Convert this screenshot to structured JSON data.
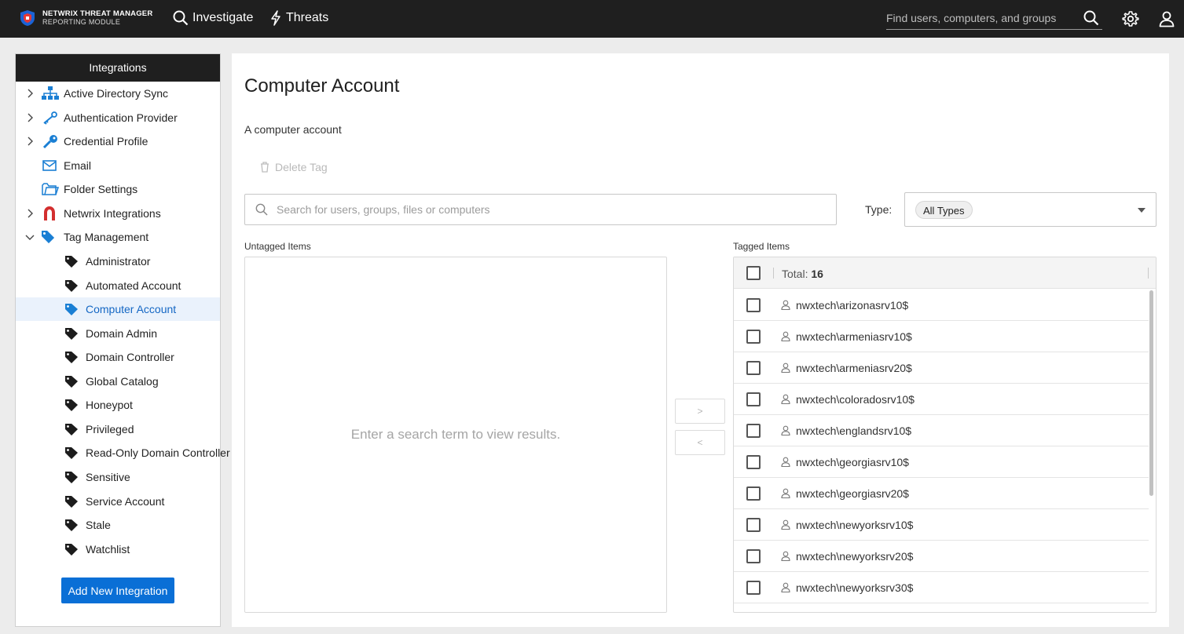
{
  "brand": {
    "line1": "NETWRIX THREAT MANAGER",
    "line2": "REPORTING MODULE"
  },
  "topnav": {
    "investigate": "Investigate",
    "threats": "Threats"
  },
  "global_search": {
    "placeholder": "Find users, computers, and groups"
  },
  "sidebar": {
    "title": "Integrations",
    "items": [
      {
        "label": "Active Directory Sync",
        "icon": "sitemap-icon",
        "expandable": true
      },
      {
        "label": "Authentication Provider",
        "icon": "key-icon",
        "expandable": true
      },
      {
        "label": "Credential Profile",
        "icon": "key-icon",
        "expandable": true
      },
      {
        "label": "Email",
        "icon": "envelope-icon",
        "expandable": false
      },
      {
        "label": "Folder Settings",
        "icon": "folder-icon",
        "expandable": false
      },
      {
        "label": "Netwrix Integrations",
        "icon": "magnet-icon",
        "expandable": true
      },
      {
        "label": "Tag Management",
        "icon": "tags-icon",
        "expandable": true,
        "expanded": true
      }
    ],
    "tags": [
      "Administrator",
      "Automated Account",
      "Computer Account",
      "Domain Admin",
      "Domain Controller",
      "Global Catalog",
      "Honeypot",
      "Privileged",
      "Read-Only Domain Controller",
      "Sensitive",
      "Service Account",
      "Stale",
      "Watchlist"
    ],
    "selected_tag": "Computer Account",
    "add_button": "Add New Integration"
  },
  "main": {
    "title": "Computer Account",
    "description": "A computer account",
    "delete_tag": "Delete Tag",
    "search_placeholder": "Search for users, groups, files or computers",
    "type_label": "Type:",
    "type_value": "All Types",
    "untagged_label": "Untagged Items",
    "untagged_empty": "Enter a search term to view results.",
    "move_right": ">",
    "move_left": "<",
    "tagged_label": "Tagged Items",
    "total_label": "Total:",
    "total_count": "16",
    "tagged_items": [
      "nwxtech\\arizonasrv10$",
      "nwxtech\\armeniasrv10$",
      "nwxtech\\armeniasrv20$",
      "nwxtech\\coloradosrv10$",
      "nwxtech\\englandsrv10$",
      "nwxtech\\georgiasrv10$",
      "nwxtech\\georgiasrv20$",
      "nwxtech\\newyorksrv10$",
      "nwxtech\\newyorksrv20$",
      "nwxtech\\newyorksrv30$"
    ]
  },
  "colors": {
    "accent": "#0a6fd6",
    "topbar": "#1f1f1f",
    "selected_bg": "#eaf2fc",
    "icon_blue": "#1a7fd4"
  }
}
